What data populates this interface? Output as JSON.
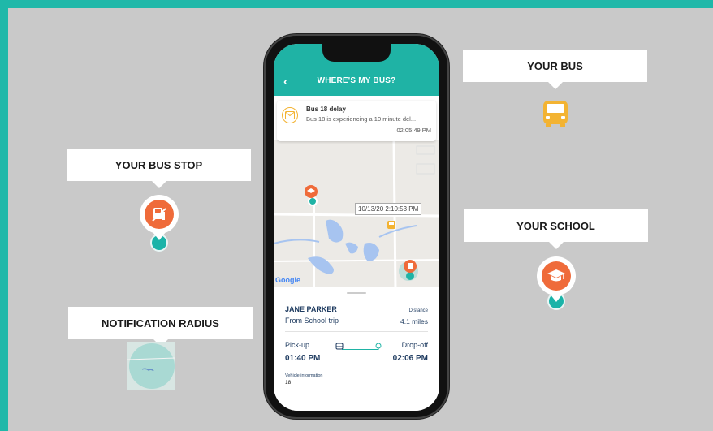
{
  "colors": {
    "frame": "#1fb8a9",
    "background": "#c9c9c9",
    "accent": "#1fb3a5",
    "orange": "#ef6b3a",
    "bus_yellow": "#f3b332",
    "navy": "#1d3a5f"
  },
  "callouts": {
    "bus": "YOUR BUS",
    "bus_stop": "YOUR BUS STOP",
    "school": "YOUR SCHOOL",
    "radius": "NOTIFICATION RADIUS"
  },
  "icons": {
    "bus": "school-bus-icon",
    "bus_stop": "bus-stop-icon",
    "school": "graduation-cap-icon",
    "back": "back-arrow-icon",
    "notification": "envelope-icon"
  },
  "app": {
    "title": "WHERE'S MY BUS?",
    "back_glyph": "‹",
    "notification": {
      "title": "Bus 18 delay",
      "body": "Bus 18 is experiencing a 10 minute del...",
      "time": "02:05:49 PM"
    },
    "map": {
      "timestamp": "10/13/20 2:10:53 PM",
      "attribution": "Google"
    },
    "trip": {
      "student": "JANE PARKER",
      "trip_name": "From School trip",
      "distance_label": "Distance",
      "distance_value": "4.1 miles",
      "pickup_label": "Pick-up",
      "pickup_time": "01:40 PM",
      "dropoff_label": "Drop-off",
      "dropoff_time": "02:06 PM",
      "vehicle_label": "Vehicle information",
      "vehicle_value": "18"
    }
  }
}
